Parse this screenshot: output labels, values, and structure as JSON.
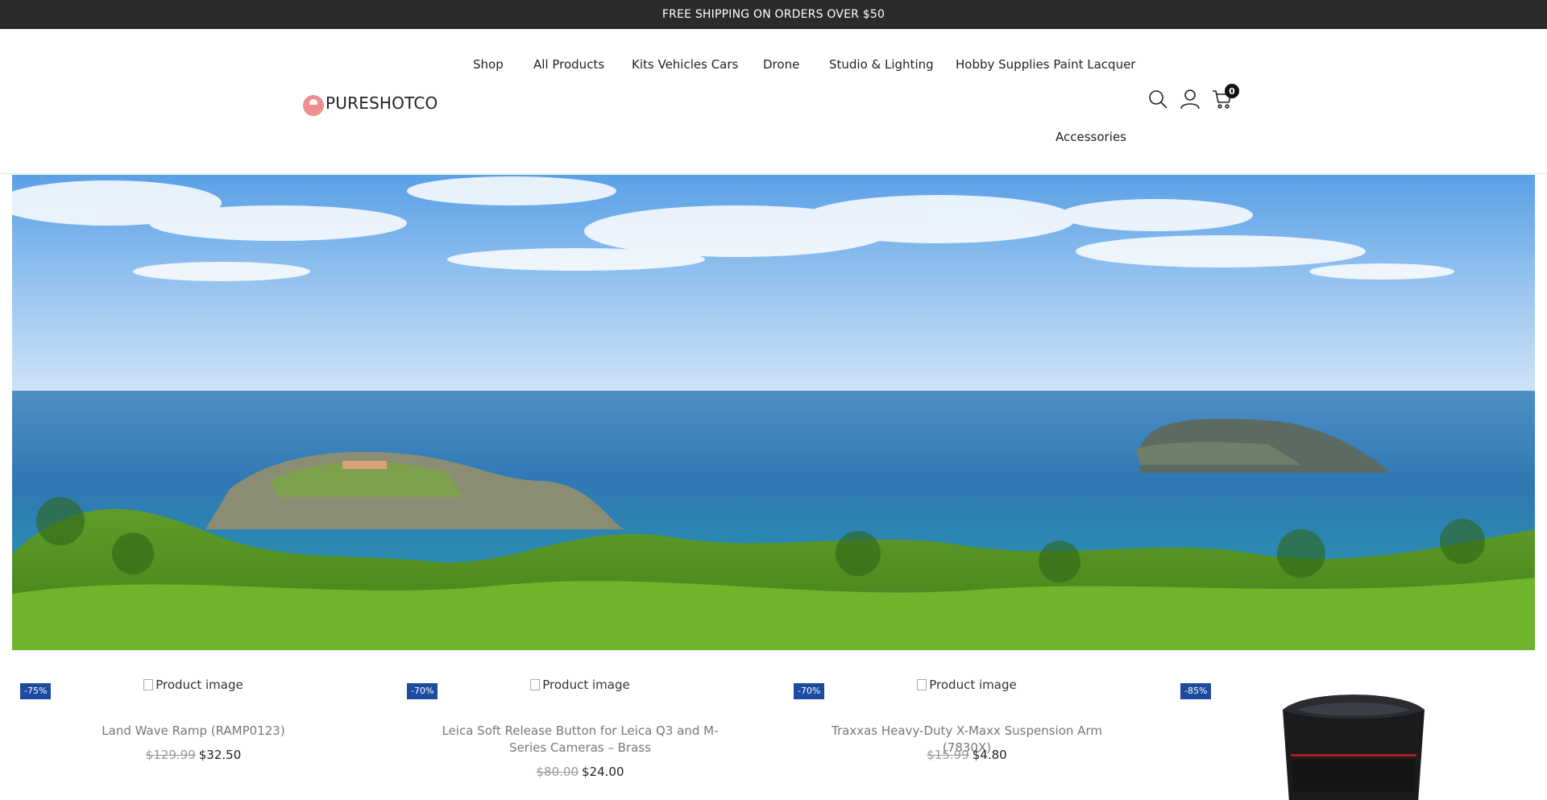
{
  "announcement": "FREE SHIPPING ON ORDERS OVER $50",
  "brand": {
    "name": "PURESHOTCO",
    "color": "#f08f8f"
  },
  "nav": [
    {
      "label": "Shop"
    },
    {
      "label": "All Products"
    },
    {
      "label": "Kits Vehicles Cars"
    },
    {
      "label": "Drone"
    },
    {
      "label": "Studio & Lighting"
    },
    {
      "label": "Hobby Supplies Paint Lacquer"
    },
    {
      "label": "Accessories"
    }
  ],
  "header_icons": {
    "search": "search-icon",
    "account": "user-icon",
    "cart": "cart-icon",
    "cart_count": "0"
  },
  "hero": {
    "alt": "Coastal landscape with sea, island and green trees"
  },
  "products": [
    {
      "badge": "-75%",
      "image_alt": "Product image",
      "title": "Land Wave Ramp (RAMP0123)",
      "old_price": "$129.99",
      "price": "$32.50"
    },
    {
      "badge": "-70%",
      "image_alt": "Product image",
      "title": "Leica Soft Release Button for Leica Q3 and M-Series Cameras – Brass",
      "old_price": "$80.00",
      "price": "$24.00"
    },
    {
      "badge": "-70%",
      "image_alt": "Product image",
      "title": "Traxxas Heavy-Duty X-Maxx Suspension Arm (7830X)",
      "old_price": "$15.99",
      "price": "$4.80"
    },
    {
      "badge": "-85%",
      "image_alt": "",
      "title": "",
      "old_price": "",
      "price": ""
    }
  ],
  "colors": {
    "topbar": "#2b2b2b",
    "badge": "#1e4ba0"
  }
}
